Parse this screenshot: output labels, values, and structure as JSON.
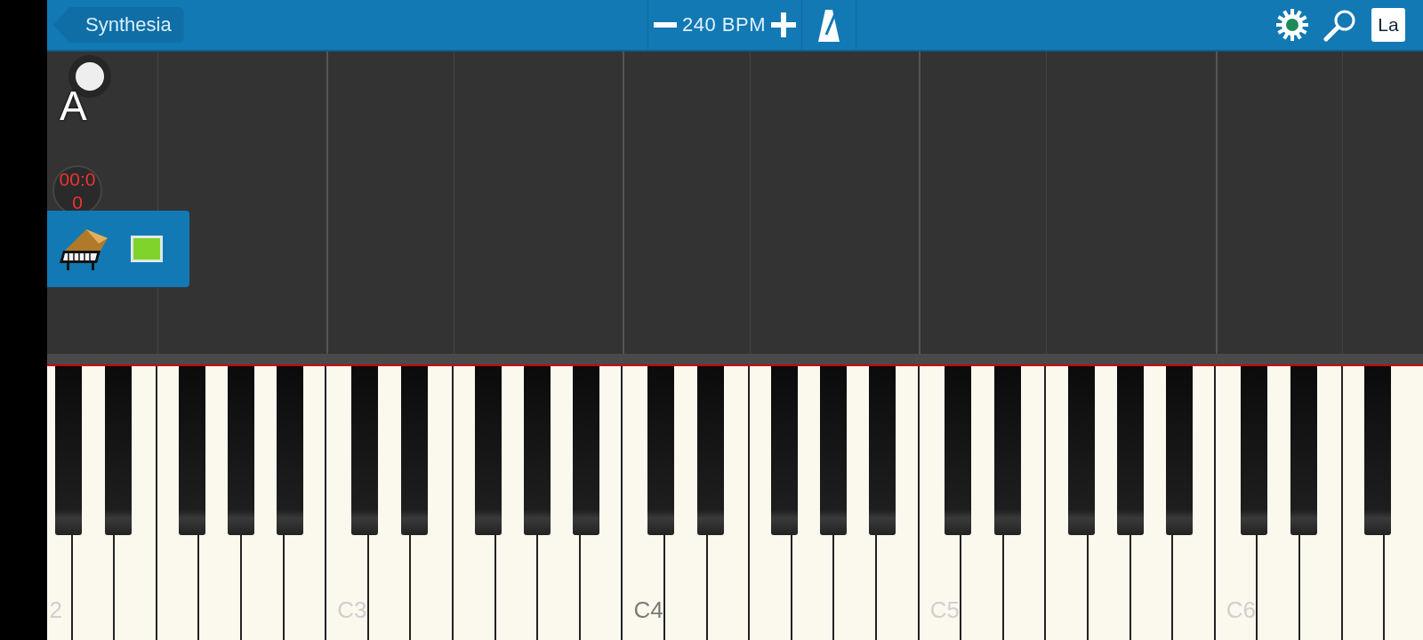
{
  "top_bar": {
    "back_button": "Synthesia",
    "tempo": "240 BPM",
    "language_button": "La"
  },
  "overlay": {
    "hand_letter": "A",
    "timer": "00:00"
  },
  "keyboard": {
    "c_labels": [
      {
        "text": "2",
        "emphasized": false
      },
      {
        "text": "C3",
        "emphasized": false
      },
      {
        "text": "C4",
        "emphasized": true
      },
      {
        "text": "C5",
        "emphasized": false
      },
      {
        "text": "C6",
        "emphasized": false
      }
    ]
  }
}
